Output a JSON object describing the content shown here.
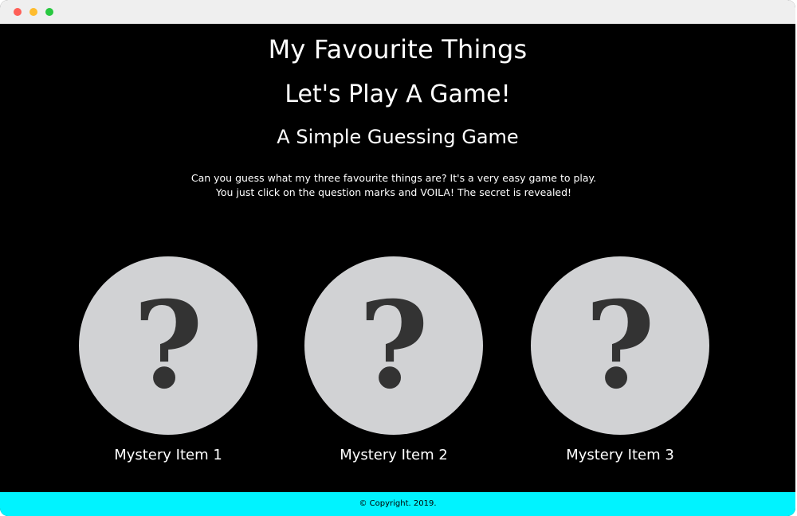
{
  "window": {
    "controls": [
      "close",
      "minimize",
      "maximize"
    ],
    "colors": {
      "close": "#fe5f57",
      "minimize": "#febc2e",
      "maximize": "#28c840",
      "titlebar": "#efefef"
    }
  },
  "header": {
    "title": "My Favourite Things",
    "subtitle": "Let's Play A Game!",
    "tagline": "A Simple Guessing Game"
  },
  "intro": {
    "text": "Can you guess what my three favourite things are? It's a very easy game to play. You just click on the question marks and VOILA! The secret is revealed!"
  },
  "items": [
    {
      "symbol": "?",
      "label": "Mystery Item 1",
      "icon": "question-mark-icon"
    },
    {
      "symbol": "?",
      "label": "Mystery Item 2",
      "icon": "question-mark-icon"
    },
    {
      "symbol": "?",
      "label": "Mystery Item 3",
      "icon": "question-mark-icon"
    }
  ],
  "footer": {
    "text": "© Copyright. 2019.",
    "background": "#00f3ff"
  },
  "colors": {
    "page_background": "#000000",
    "circle": "#d1d2d4",
    "question_mark": "#333333",
    "text": "#ffffff"
  }
}
